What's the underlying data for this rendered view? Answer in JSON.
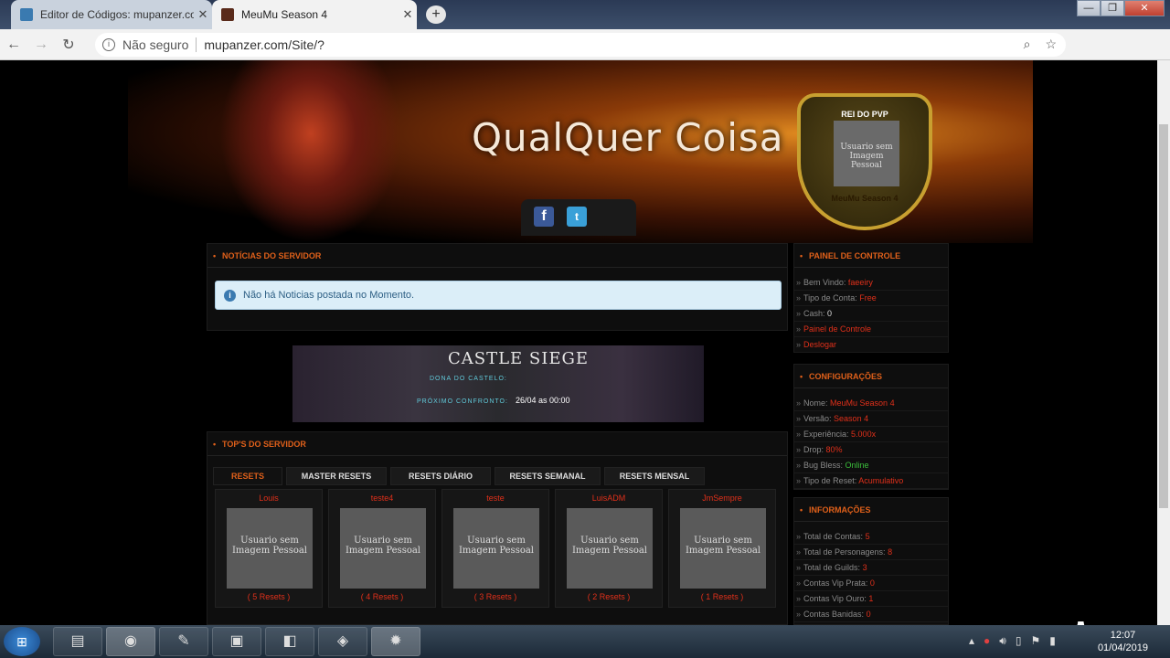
{
  "browser": {
    "tabs": [
      {
        "title": "Editor de Códigos: mupanzer.co",
        "close": "✕"
      },
      {
        "title": "MeuMu Season 4",
        "close": "✕"
      }
    ],
    "new_tab": "+",
    "address": {
      "security": "Não seguro",
      "url": "mupanzer.com/Site/?"
    },
    "window_controls": {
      "minimize": "—",
      "maximize": "❐",
      "close": "✕"
    }
  },
  "site": {
    "title": "QualQuer Coisa",
    "pvp": {
      "label": "REI DO PVP",
      "avatar_text": "Usuario sem Imagem Pessoal",
      "server": "MeuMu Season 4"
    },
    "social": {
      "facebook": "f",
      "twitter": "t"
    }
  },
  "news": {
    "heading": "NOTÍCIAS DO SERVIDOR",
    "alert": "Não há Noticias postada no Momento."
  },
  "castle": {
    "title": "CASTLE SIEGE",
    "owner_label": "DONA DO CASTELO:",
    "next_label": "PRÓXIMO CONFRONTO:",
    "next_value": "26/04 as 00:00"
  },
  "tops": {
    "heading": "TOP'S DO SERVIDOR",
    "tabs": [
      "RESETS",
      "MASTER RESETS",
      "RESETS DIÁRIO",
      "RESETS SEMANAL",
      "RESETS MENSAL"
    ],
    "players": [
      {
        "name": "Louis",
        "avatar": "Usuario sem Imagem Pessoal",
        "resets": "( 5 Resets )"
      },
      {
        "name": "teste4",
        "avatar": "Usuario sem Imagem Pessoal",
        "resets": "( 4 Resets )"
      },
      {
        "name": "teste",
        "avatar": "Usuario sem Imagem Pessoal",
        "resets": "( 3 Resets )"
      },
      {
        "name": "LuisADM",
        "avatar": "Usuario sem Imagem Pessoal",
        "resets": "( 2 Resets )"
      },
      {
        "name": "JmSempre",
        "avatar": "Usuario sem Imagem Pessoal",
        "resets": "( 1 Resets )"
      }
    ]
  },
  "control_panel": {
    "heading": "PAINEL DE CONTROLE",
    "welcome_label": "Bem Vindo:",
    "welcome_value": "faeeiry",
    "account_label": "Tipo de Conta:",
    "account_value": "Free",
    "cash_label": "Cash:",
    "cash_value": "0",
    "panel_link": "Painel de Controle",
    "logout_link": "Deslogar"
  },
  "config": {
    "heading": "CONFIGURAÇÕES",
    "rows": [
      {
        "label": "Nome:",
        "value": "MeuMu Season 4"
      },
      {
        "label": "Versão:",
        "value": "Season 4"
      },
      {
        "label": "Experiência:",
        "value": "5.000x"
      },
      {
        "label": "Drop:",
        "value": "80%"
      },
      {
        "label": "Bug Bless:",
        "value": "Online"
      },
      {
        "label": "Tipo de Reset:",
        "value": "Acumulativo"
      }
    ]
  },
  "info": {
    "heading": "INFORMAÇÕES",
    "rows": [
      {
        "label": "Total de Contas:",
        "value": "5"
      },
      {
        "label": "Total de Personagens:",
        "value": "8"
      },
      {
        "label": "Total de Guilds:",
        "value": "3"
      },
      {
        "label": "Contas Vip Prata:",
        "value": "0"
      },
      {
        "label": "Contas Vip Ouro:",
        "value": "1"
      },
      {
        "label": "Contas Banidas:",
        "value": "0"
      }
    ]
  },
  "taskbar": {
    "time": "12:07",
    "date": "01/04/2019"
  }
}
